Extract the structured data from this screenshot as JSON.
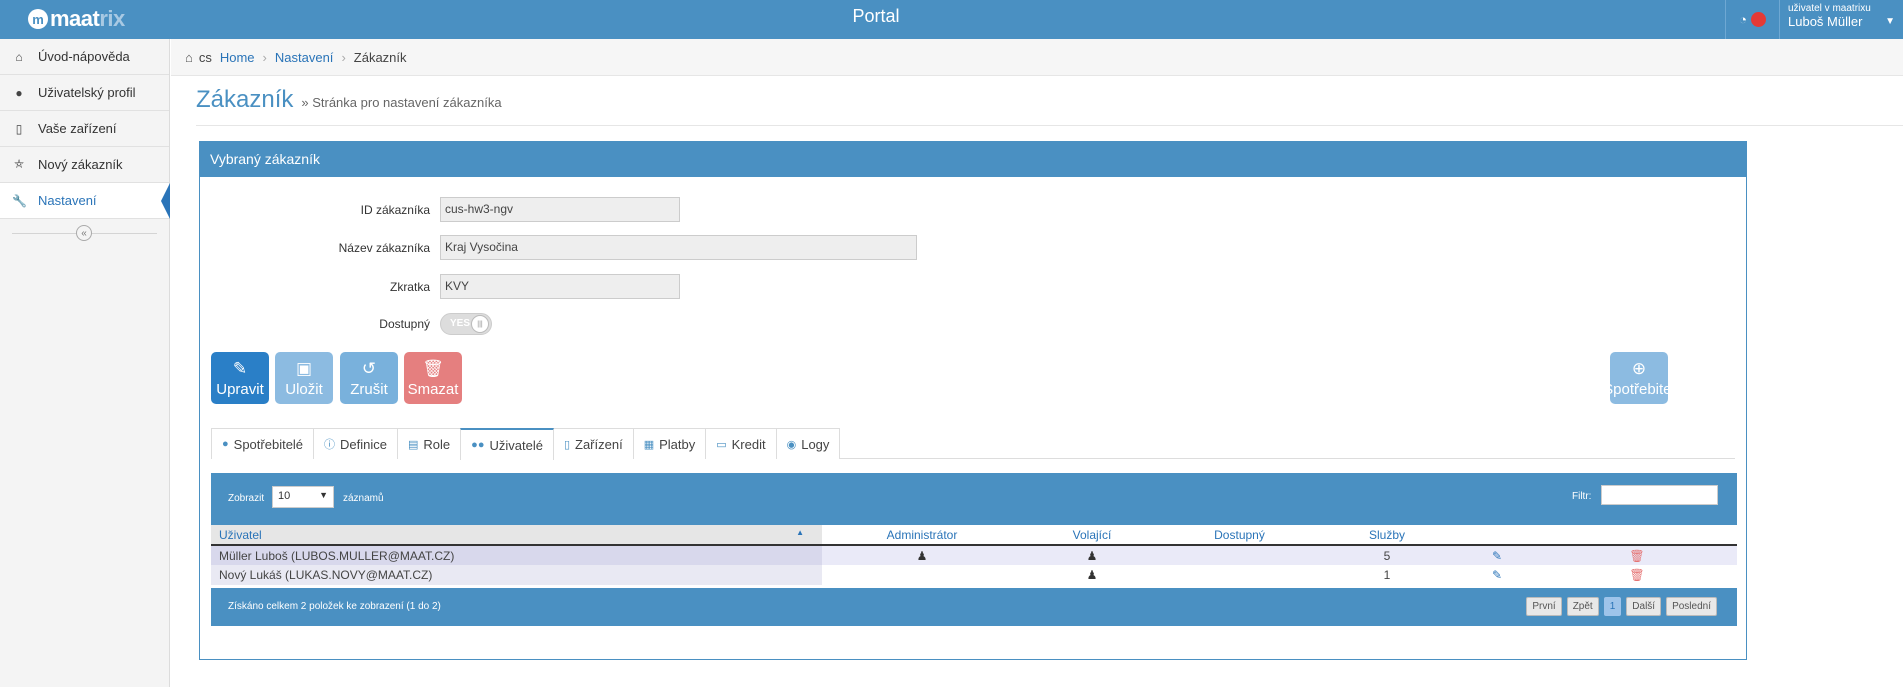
{
  "app": {
    "logo_main": "maat",
    "logo_accent": "rix",
    "title": "Portal"
  },
  "user": {
    "caption": "uživatel v maatrixu",
    "name": "Luboš Müller"
  },
  "sidebar": {
    "items": [
      {
        "label": "Úvod-nápověda",
        "icon": "home-icon"
      },
      {
        "label": "Uživatelský profil",
        "icon": "user-icon"
      },
      {
        "label": "Vaše zařízení",
        "icon": "mobile-icon"
      },
      {
        "label": "Nový zákazník",
        "icon": "cart-icon"
      },
      {
        "label": "Nastavení",
        "icon": "wrench-icon",
        "active": true
      }
    ]
  },
  "breadcrumb": {
    "lang": "cs",
    "home": "Home",
    "settings": "Nastavení",
    "current": "Zákazník"
  },
  "page": {
    "title": "Zákazník",
    "subtitle": "» Stránka pro nastavení zákazníka"
  },
  "panel": {
    "title": "Vybraný zákazník",
    "fields": {
      "id_label": "ID zákazníka",
      "id_value": "cus-hw3-ngv",
      "name_label": "Název zákazníka",
      "name_value": "Kraj Vysočina",
      "abbr_label": "Zkratka",
      "abbr_value": "KVY",
      "available_label": "Dostupný",
      "available_toggle": "YES"
    },
    "buttons": {
      "edit": "Upravit",
      "save": "Uložit",
      "cancel": "Zrušit",
      "delete": "Smazat",
      "consumer": "Spotřebitel"
    }
  },
  "tabs": [
    {
      "label": "Spotřebitelé",
      "icon": "circle-icon"
    },
    {
      "label": "Definice",
      "icon": "info-icon"
    },
    {
      "label": "Role",
      "icon": "briefcase-icon"
    },
    {
      "label": "Uživatelé",
      "icon": "users-icon",
      "active": true
    },
    {
      "label": "Zařízení",
      "icon": "mobile-icon"
    },
    {
      "label": "Platby",
      "icon": "card-icon"
    },
    {
      "label": "Kredit",
      "icon": "book-icon"
    },
    {
      "label": "Logy",
      "icon": "eye-icon"
    }
  ],
  "table": {
    "show_label": "Zobrazit",
    "page_size": "10",
    "records_label": "záznamů",
    "filter_label": "Filtr:",
    "columns": [
      "Uživatel",
      "Administrátor",
      "Volající",
      "Dostupný",
      "Služby"
    ],
    "rows": [
      {
        "user": "Müller Luboš (LUBOS.MULLER@MAAT.CZ)",
        "admin": true,
        "caller": true,
        "available": false,
        "services": "5"
      },
      {
        "user": "Nový Lukáš (LUKAS.NOVY@MAAT.CZ)",
        "admin": false,
        "caller": true,
        "available": false,
        "services": "1"
      }
    ],
    "summary": "Získáno celkem 2 položek ke zobrazení (1 do 2)",
    "pager": {
      "first": "První",
      "prev": "Zpět",
      "current": "1",
      "next": "Další",
      "last": "Poslední"
    }
  },
  "colors": {
    "primary": "#4a90c2",
    "edit": "#2a7fc7",
    "delete": "#e57f7f",
    "status_dot": "#e53935"
  }
}
